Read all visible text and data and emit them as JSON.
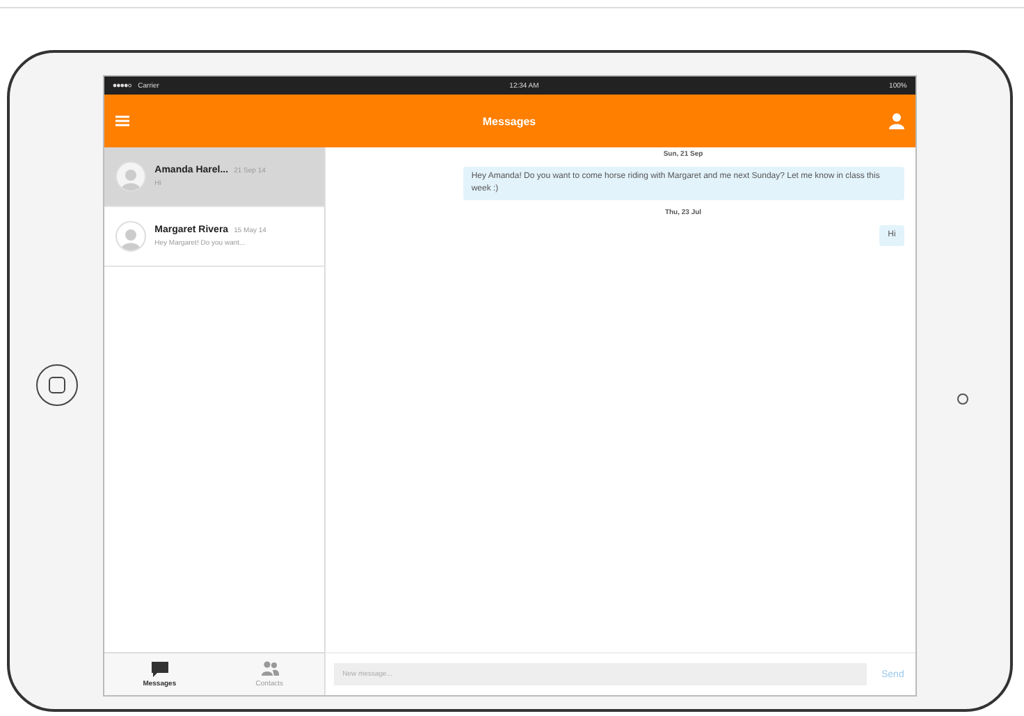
{
  "status_bar": {
    "carrier": "Carrier",
    "time": "12:34 AM",
    "battery": "100%"
  },
  "header": {
    "title": "Messages"
  },
  "conversations": [
    {
      "name": "Amanda Harel...",
      "date": "21 Sep 14",
      "preview": "Hi",
      "selected": true
    },
    {
      "name": "Margaret Rivera",
      "date": "15 May 14",
      "preview": "Hey Margaret! Do you want...",
      "selected": false
    }
  ],
  "tabs": [
    {
      "label": "Messages",
      "kind": "messages",
      "selected": true
    },
    {
      "label": "Contacts",
      "kind": "contacts",
      "selected": false
    }
  ],
  "thread": [
    {
      "kind": "date",
      "text": "Sun, 21 Sep"
    },
    {
      "kind": "message",
      "text": "Hey Amanda! Do you want to come horse riding with Margaret and me next Sunday? Let me know in class this week :)"
    },
    {
      "kind": "date",
      "text": "Thu, 23 Jul"
    },
    {
      "kind": "message",
      "text": "Hi"
    }
  ],
  "composer": {
    "placeholder": "New message...",
    "send": "Send"
  }
}
